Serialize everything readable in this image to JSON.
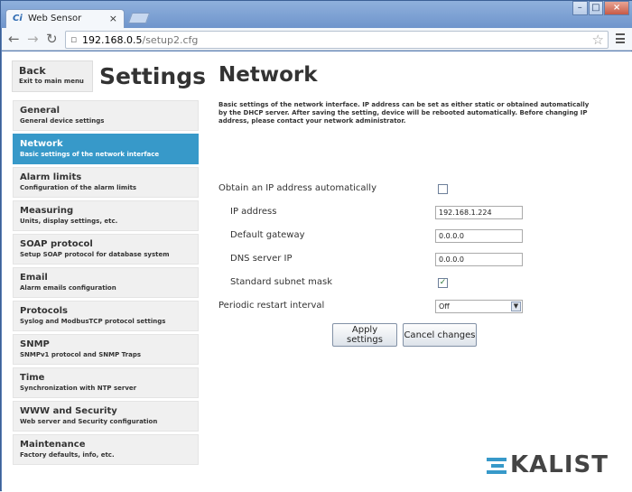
{
  "browser": {
    "tab_title": "Web Sensor",
    "tab_favicon": "Ci",
    "tab_close": "×",
    "window_minimize": "–",
    "window_maximize": "□",
    "window_close": "×",
    "url_host": "192.168.0.5",
    "url_path": "/setup2.cfg"
  },
  "header": {
    "back_title": "Back",
    "back_subtitle": "Exit to main menu",
    "settings_title": "Settings"
  },
  "sidebar": {
    "items": [
      {
        "title": "General",
        "desc": "General device settings"
      },
      {
        "title": "Network",
        "desc": "Basic settings of the network interface"
      },
      {
        "title": "Alarm limits",
        "desc": "Configuration of the alarm limits"
      },
      {
        "title": "Measuring",
        "desc": "Units, display settings, etc."
      },
      {
        "title": "SOAP protocol",
        "desc": "Setup SOAP protocol for database system"
      },
      {
        "title": "Email",
        "desc": "Alarm emails configuration"
      },
      {
        "title": "Protocols",
        "desc": "Syslog and ModbusTCP protocol settings"
      },
      {
        "title": "SNMP",
        "desc": "SNMPv1 protocol and SNMP Traps"
      },
      {
        "title": "Time",
        "desc": "Synchronization with NTP server"
      },
      {
        "title": "WWW and Security",
        "desc": "Web server and Security configuration"
      },
      {
        "title": "Maintenance",
        "desc": "Factory defaults, info, etc."
      }
    ],
    "active_index": 1
  },
  "main": {
    "title": "Network",
    "description": "Basic settings of the network interface. IP address can be set as either static or obtained automatically by the DHCP server. After saving the setting, device will be rebooted automatically. Before changing IP address, please contact your network administrator.",
    "obtain_label": "Obtain an IP address automatically",
    "obtain_checked": false,
    "ip_label": "IP address",
    "ip_value": "192.168.1.224",
    "gateway_label": "Default gateway",
    "gateway_value": "0.0.0.0",
    "dns_label": "DNS server IP",
    "dns_value": "0.0.0.0",
    "mask_label": "Standard subnet mask",
    "mask_checked": true,
    "restart_label": "Periodic restart interval",
    "restart_value": "Off",
    "apply_label": "Apply settings",
    "cancel_label": "Cancel changes"
  },
  "brand": {
    "logo_text": "KALIST",
    "accent_color": "#3799c9"
  }
}
